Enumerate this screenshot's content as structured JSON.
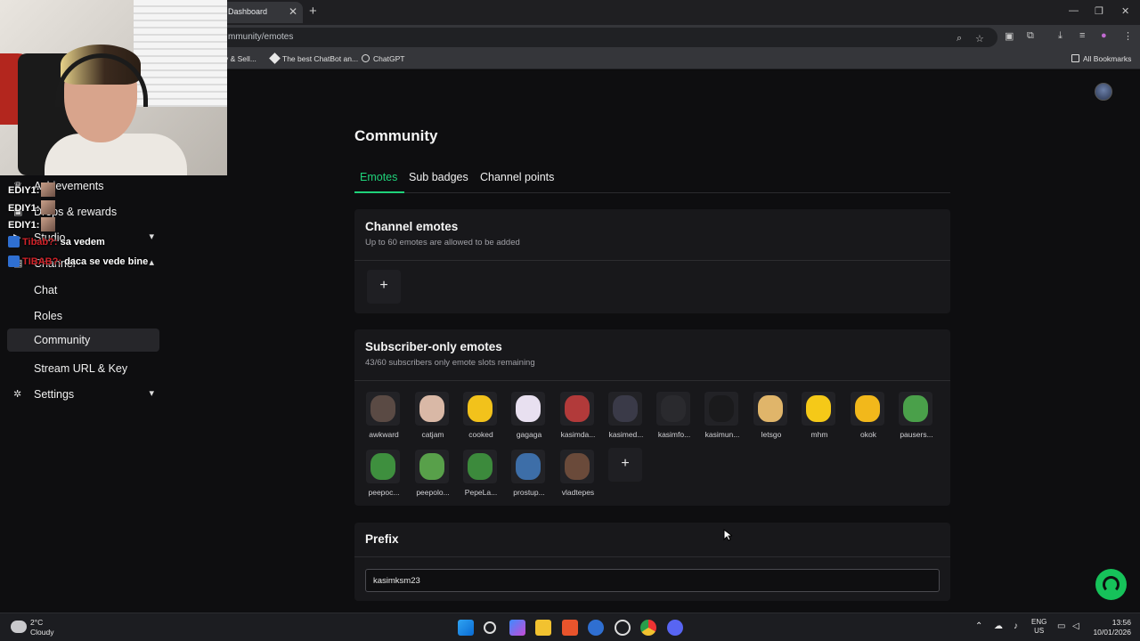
{
  "browser": {
    "tab_title": "Dashboard",
    "tab_close": "✕",
    "new_tab": "+",
    "url": "mmunity/emotes",
    "bookmarks": [
      {
        "label": "y & Sell..."
      },
      {
        "label": "The best ChatBot an..."
      },
      {
        "label": "ChatGPT"
      }
    ],
    "all_bookmarks": "All Bookmarks",
    "window_controls": {
      "minimize": "—",
      "restore": "❐",
      "close": "✕"
    }
  },
  "chat_overlay": [
    {
      "user": "EDIY1:",
      "message": ""
    },
    {
      "user": "EDIY1:",
      "message": ""
    },
    {
      "user": "EDIY1:",
      "message": ""
    },
    {
      "user": "Tibab?:",
      "message": "sa vedem"
    },
    {
      "user": "TIBAB?:",
      "message": "daca se vede bine"
    }
  ],
  "sidebar": {
    "items": [
      {
        "label": "Achievements",
        "icon": "trophy-icon"
      },
      {
        "label": "Drops & rewards",
        "icon": "gift-icon"
      },
      {
        "label": "Studio",
        "icon": "studio-icon",
        "chevron": "▾"
      },
      {
        "label": "Channel",
        "icon": "channel-icon",
        "chevron": "▴"
      },
      {
        "label": "Chat"
      },
      {
        "label": "Roles"
      },
      {
        "label": "Community",
        "active": true
      },
      {
        "label": "Stream URL & Key"
      },
      {
        "label": "Settings",
        "icon": "gear-icon",
        "chevron": "▾"
      }
    ]
  },
  "main": {
    "title": "Community",
    "tabs": [
      {
        "label": "Emotes",
        "active": true
      },
      {
        "label": "Sub badges"
      },
      {
        "label": "Channel points"
      }
    ],
    "channel_emotes": {
      "title": "Channel emotes",
      "subtitle": "Up to 60 emotes are allowed to be added",
      "add": "+"
    },
    "subscriber_emotes": {
      "title": "Subscriber-only emotes",
      "subtitle": "43/60 subscribers only emote slots remaining",
      "add": "+",
      "emotes": [
        {
          "name": "awkward",
          "color": "#5a4a44"
        },
        {
          "name": "catjam",
          "color": "#d9b8a6"
        },
        {
          "name": "cooked",
          "color": "#f2c21b"
        },
        {
          "name": "gagaga",
          "color": "#e8e0f0"
        },
        {
          "name": "kasimda...",
          "color": "#b23a3a"
        },
        {
          "name": "kasimed...",
          "color": "#3a3a48"
        },
        {
          "name": "kasimfo...",
          "color": "#2a2a2e"
        },
        {
          "name": "kasimun...",
          "color": "#1a1a1c"
        },
        {
          "name": "letsgo",
          "color": "#e0b56a"
        },
        {
          "name": "mhm",
          "color": "#f5c918"
        },
        {
          "name": "okok",
          "color": "#f2b81b"
        },
        {
          "name": "pausers...",
          "color": "#4aa04a"
        },
        {
          "name": "peepoc...",
          "color": "#3e8f3e"
        },
        {
          "name": "peepolo...",
          "color": "#58a04a"
        },
        {
          "name": "PepeLa...",
          "color": "#3c8a3c"
        },
        {
          "name": "prostup...",
          "color": "#3d6ea8"
        },
        {
          "name": "vladtepes",
          "color": "#6a4a3a"
        }
      ]
    },
    "prefix": {
      "title": "Prefix",
      "value": "kasimksm23"
    }
  },
  "taskbar": {
    "temperature": "2°C",
    "condition": "Cloudy",
    "lang_top": "ENG",
    "lang_bottom": "US",
    "time": "13:56",
    "date": "10/01/2026"
  }
}
